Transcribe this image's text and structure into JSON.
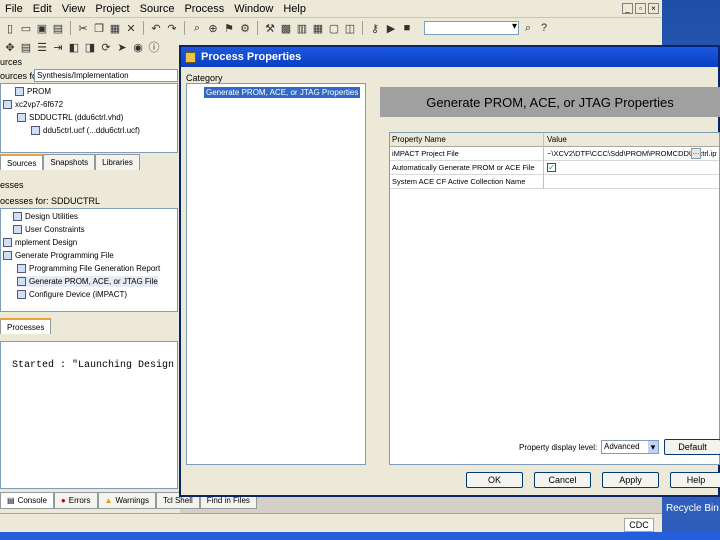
{
  "menu": {
    "items": [
      "File",
      "Edit",
      "View",
      "Project",
      "Source",
      "Process",
      "Window",
      "Help"
    ]
  },
  "sources_panel": {
    "title": "urces",
    "combo_label": "ources for:",
    "combo_value": "Synthesis/Implementation",
    "tree": [
      "PROM",
      "xc2vp7-6f672",
      "SDDUCTRL (ddu6ctrl.vhd)",
      "ddu5ctrl.ucf (...ddu6ctrl.ucf)"
    ],
    "tabs": [
      "Sources",
      "Snapshots",
      "Libraries"
    ]
  },
  "processes_panel": {
    "title": "esses",
    "header": "ocesses for: SDDUCTRL",
    "items": [
      "Design Utilities",
      "User Constraints",
      "mplement Design",
      "Generate Programming File",
      "Programming File Generation Report",
      "Generate PROM, ACE, or JTAG File",
      "Configure Device (iMPACT)"
    ],
    "tab": "Processes"
  },
  "console": {
    "text": "Started : \"Launching Design",
    "tabs": [
      "Console",
      "Errors",
      "Warnings",
      "Tcl Shell",
      "Find in Files"
    ]
  },
  "status": {
    "cell": "CDC"
  },
  "desktop": {
    "recycle_bin": "Recycle Bin"
  },
  "dialog": {
    "title": "Process Properties",
    "category_label": "Category",
    "category_item": "Generate PROM, ACE, or JTAG Properties",
    "banner": "Generate PROM, ACE, or JTAG Properties",
    "table_header": {
      "name": "Property Name",
      "value": "Value"
    },
    "rows": [
      {
        "name": "iMPACT Project File",
        "value": "~\\XCV2\\DTF\\CCC\\Sdd\\PROM\\PROMCDDU6ctrl.ipf"
      },
      {
        "name": "Automatically Generate PROM or ACE File",
        "value": "checked"
      },
      {
        "name": "System ACE CF Active Collection Name",
        "value": ""
      }
    ],
    "level_label": "Property display level:",
    "level_value": "Advanced",
    "buttons": {
      "default": "Default",
      "ok": "OK",
      "cancel": "Cancel",
      "apply": "Apply",
      "help": "Help"
    }
  }
}
